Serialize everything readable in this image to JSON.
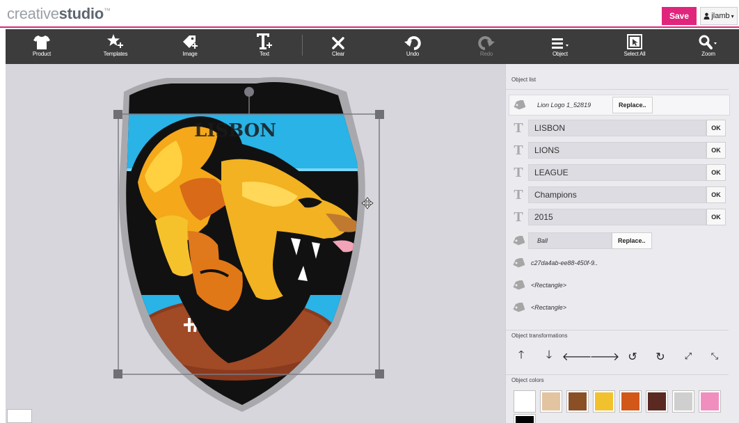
{
  "header": {
    "logo_light": "creative",
    "logo_bold": "studio",
    "logo_mark": "™",
    "save_label": "Save",
    "user_label": "jlamb",
    "accent_color": "#e0267c"
  },
  "toolbar": {
    "product": "Product",
    "templates": "Templates",
    "image": "Image",
    "text": "Text",
    "clear": "Clear",
    "undo": "Undo",
    "redo": "Redo",
    "object": "Object",
    "select_all": "Select All",
    "zoom": "Zoom"
  },
  "canvas": {
    "design_text": "LISBON"
  },
  "panel": {
    "object_list_title": "Object list",
    "objects": [
      {
        "type": "image",
        "label": "Lion Logo 1_52819",
        "action": "Replace.."
      },
      {
        "type": "text",
        "value": "LISBON",
        "action": "OK"
      },
      {
        "type": "text",
        "value": "LIONS",
        "action": "OK"
      },
      {
        "type": "text",
        "value": "LEAGUE",
        "action": "OK"
      },
      {
        "type": "text",
        "value": "Champions",
        "action": "OK"
      },
      {
        "type": "text",
        "value": "2015",
        "action": "OK"
      },
      {
        "type": "image",
        "label": "Ball",
        "action": "Replace.."
      },
      {
        "type": "image",
        "label": "c27da4ab-ee88-450f-9.."
      },
      {
        "type": "shape",
        "label": "<Rectangle>"
      },
      {
        "type": "shape",
        "label": "<Rectangle>"
      }
    ],
    "transformations_title": "Object transformations",
    "transformations": [
      "move-up",
      "move-down",
      "move-left",
      "move-right",
      "rotate-left",
      "rotate-right",
      "enlarge",
      "shrink"
    ],
    "colors_title": "Object colors",
    "colors": [
      "#ffffff",
      "#e3c4a0",
      "#8a4f24",
      "#f2c12e",
      "#d2581a",
      "#5a2a22",
      "#cfcfcf",
      "#f08fbf",
      "#000000"
    ]
  }
}
